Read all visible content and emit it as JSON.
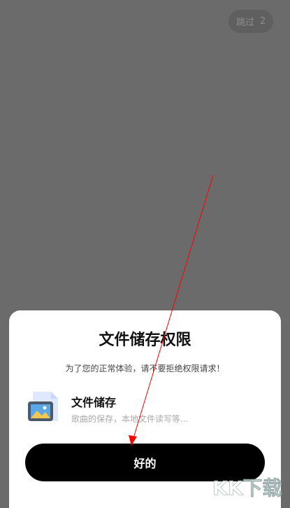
{
  "skip": {
    "label": "跳过",
    "countdown": "2"
  },
  "dialog": {
    "title": "文件储存权限",
    "subtitle": "为了您的正常体验，请不要拒绝权限请求！",
    "permission": {
      "icon": "image-file-icon",
      "title": "文件储存",
      "description": "歌曲的保存，本地文件读写等..."
    },
    "ok_label": "好的"
  },
  "watermark": {
    "text": "KK下载"
  },
  "colors": {
    "overlay": "#6b6b6b",
    "button": "#000000",
    "arrow": "#ff0000"
  }
}
